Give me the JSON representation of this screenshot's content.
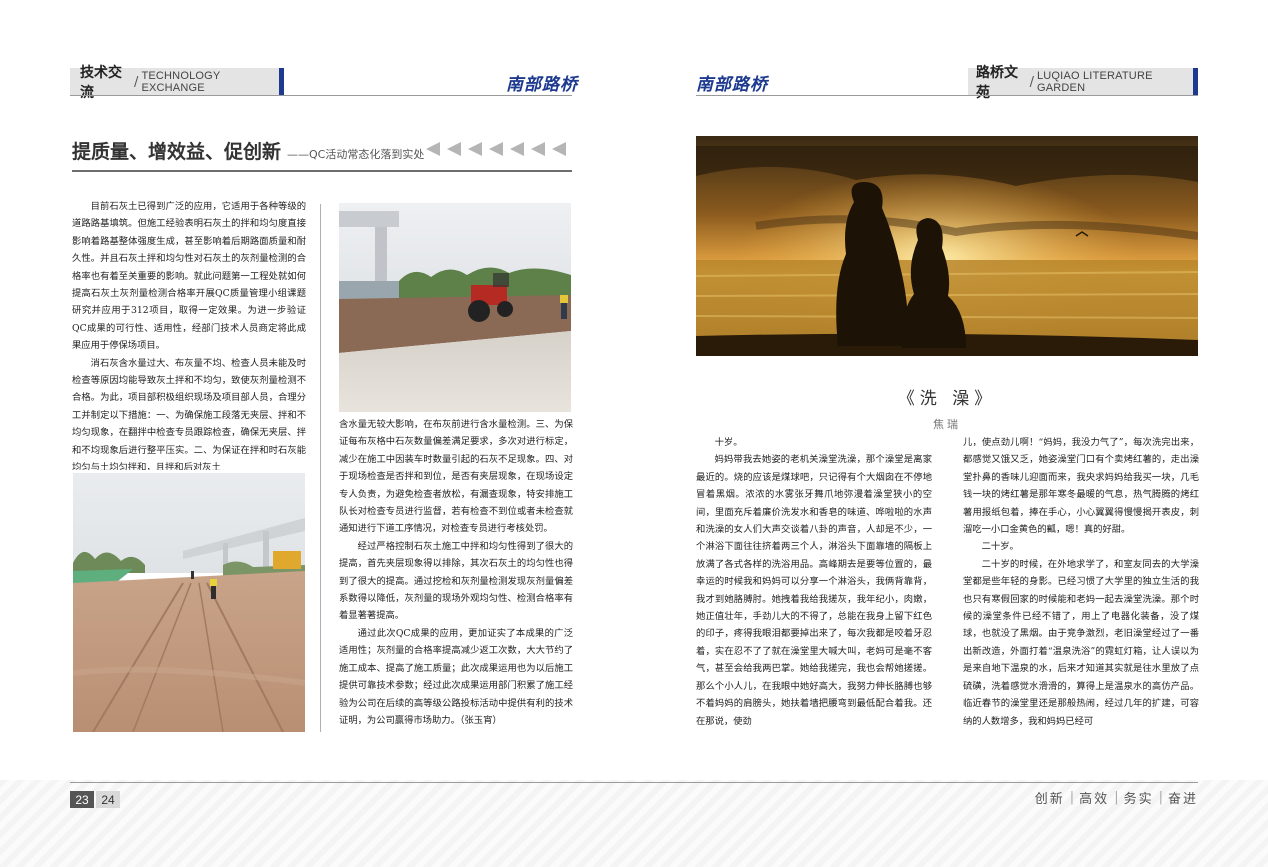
{
  "left_header": {
    "section_cn": "技术交流",
    "separator": "/",
    "section_en": "TECHNOLOGY EXCHANGE",
    "brand": "南部路桥"
  },
  "right_header": {
    "brand": "南部路桥",
    "section_cn": "路桥文苑",
    "separator": "/",
    "section_en": "LUQIAO  LITERATURE GARDEN"
  },
  "article": {
    "title": "提质量、增效益、促创新",
    "subtitle": "——QC活动常态化落到实处",
    "col1": [
      "目前石灰土已得到广泛的应用，它适用于各种等级的道路路基填筑。但施工经验表明石灰土的拌和均匀度直接影响着路基整体强度生成，甚至影响着后期路面质量和耐久性。并且石灰土拌和均匀性对石灰土的灰剂量检测的合格率也有着至关重要的影响。就此问题第一工程处就如何提高石灰土灰剂量检测合格率开展QC质量管理小组课题研究并应用于312项目，取得一定效果。为进一步验证QC成果的可行性、适用性，经部门技术人员商定将此成果应用于停保场项目。",
      "消石灰含水量过大、布灰量不均、检查人员未能及时检查等原因均能导致灰土拌和不均匀，致使灰剂量检测不合格。为此，项目部积极组织现场及项目部人员，合理分工并制定以下措施：一、为确保施工段落无夹层、拌和不均匀现象，在翻拌中检查专员跟踪检查，确保无夹层、拌和不均现象后进行整平压实。二、为保证在拌和时石灰能均匀与土均匀拌和，且拌和后对灰土"
    ],
    "col2": [
      "含水量无较大影响，在布灰前进行含水量检测。三、为保证每布灰格中石灰数量偏差满足要求，多次对进行标定，减少在施工中因装车时数量引起的石灰不足现象。四、对于现场检查是否拌和到位，是否有夹层现象，在现场设定专人负责，为避免检查者放松，有漏查现象，特安排施工队长对检查专员进行监督，若有检查不到位或者未检查就通知进行下道工序情况，对检查专员进行考核处罚。",
      "经过严格控制石灰土施工中拌和均匀性得到了很大的提高，首先夹层现象得以排除，其次石灰土的均匀性也得到了很大的提高。通过挖检和灰剂量检测发现灰剂量偏差系数得以降低，灰剂量的现场外观均匀性、检测合格率有着显著著提高。",
      "通过此次QC成果的应用，更加证实了本成果的广泛适用性；灰剂量的合格率提高减少返工次数，大大节约了施工成本、提高了施工质量；此次成果运用也为以后施工提供可靠技术参数；经过此次成果运用部门积累了施工经验为公司在后续的高等级公路投标活动中提供有利的技术证明，为公司赢得市场助力。（张玉宵）"
    ]
  },
  "essay": {
    "title": "《洗  澡》",
    "author": "焦瑞",
    "col1": [
      {
        "text": "十岁。",
        "indent": true
      },
      {
        "text": "妈妈带我去她姿的老机关澡堂洗澡，那个澡堂是离家最近的。烧的应该是煤球吧，只记得有个大烟囱在不停地冒着黑烟。浓浓的水雾张牙舞爪地弥漫着澡堂狭小的空间，里面充斥着廉价洗发水和香皂的味道、哗啦啦的水声和洗澡的女人们大声交谈着八卦的声音，人却是不少，一个淋浴下面往往挤着两三个人，淋浴头下面靠墙的隔板上放满了各式各样的洗浴用品。高峰期去是要等位置的，最幸运的时候我和妈妈可以分享一个淋浴头，我俩背靠背，我才到她胳膊肘。她拽着我给我搓灰，我年纪小，肉嫩，她正值壮年，手劲儿大的不得了，总能在我身上留下红色的印子，疼得我眼泪都要掉出来了，每次我都是咬着牙忍着，实在忍不了了就在澡堂里大喊大叫，老妈可是毫不客气，甚至会给我两巴掌。她给我搓完，我也会帮她搓搓。那么个小人儿，在我眼中她好高大，我努力伸长胳膊也够不着妈妈的肩膀头，她扶着墙把腰弯到最低配合着我。还在那说，使劲",
        "indent": true
      }
    ],
    "col2": [
      {
        "text": "儿，使点劲儿啊！“妈妈，我没力气了”，每次洗完出来，都感觉又饿又乏，她姿澡堂门口有个卖烤红薯的，走出澡堂扑鼻的香味儿迎面而来，我央求妈妈给我买一块，几毛钱一块的烤红薯是那年寒冬最暖的气息，热气腾腾的烤红薯用报纸包着，捧在手心，小心翼翼得慢慢揭开表皮，刺溜吃一小口金黄色的瓤，嗯！真的好甜。",
        "indent": false
      },
      {
        "text": "二十岁。",
        "indent": true
      },
      {
        "text": "二十岁的时候，在外地求学了，和室友同去的大学澡堂都是些年轻的身影。已经习惯了大学里的独立生活的我也只有寒假回家的时候能和老妈一起去澡堂洗澡。那个时候的澡堂条件已经不错了，用上了电器化装备，没了煤球，也就没了黑烟。由于竞争激烈，老旧澡堂经过了一番出新改造，外面打着“温泉洗浴”的霓虹灯箱，让人误以为是来自地下温泉的水，后来才知道其实就是往水里放了点硫磺，洗着感觉水滑滑的，算得上是温泉水的高仿产品。临近春节的澡堂里还是那般热闹，经过几年的扩建，可容纳的人数增多，我和妈妈已经可",
        "indent": true
      }
    ]
  },
  "footer": {
    "page_left": "23",
    "page_right": "24",
    "motto": [
      "创新",
      "高效",
      "务实",
      "奋进"
    ]
  },
  "colors": {
    "brand_blue": "#1d3a8f",
    "rule_gray": "#9a9a9a",
    "tab_gray": "#e4e4e4"
  }
}
